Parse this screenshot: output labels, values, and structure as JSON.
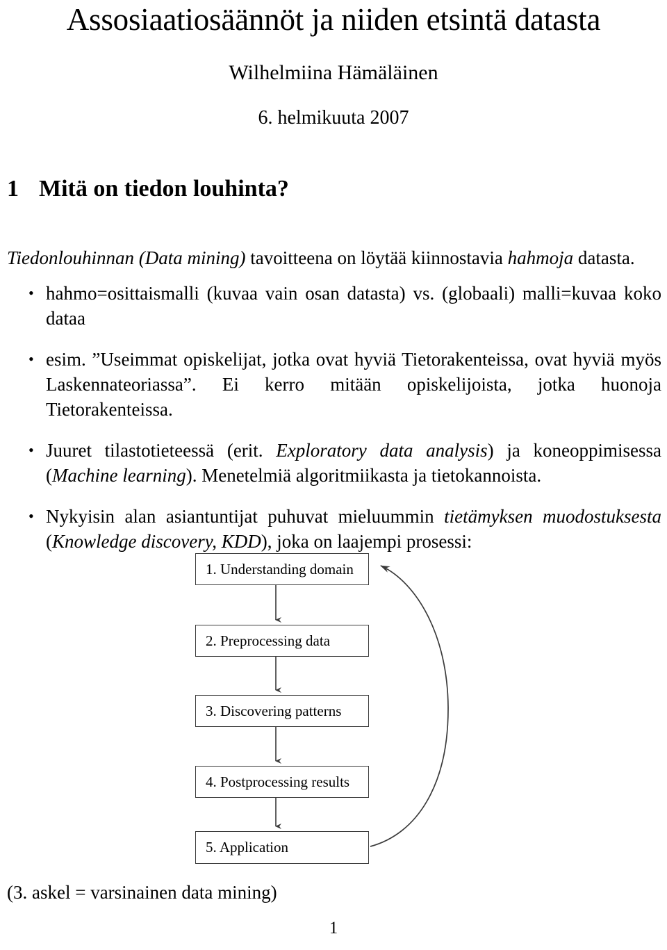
{
  "document": {
    "title": "Assosiaatiosäännöt ja niiden etsintä datasta",
    "author": "Wilhelmiina Hämäläinen",
    "date": "6. helmikuuta 2007",
    "page_number": "1"
  },
  "section": {
    "number": "1",
    "heading": "Mitä on tiedon louhinta?"
  },
  "intro": {
    "italic_lead": "Tiedonlouhinnan",
    "paren_italic": "(Data mining)",
    "mid": " tavoitteena on löytää kiinnostavia ",
    "italic_tail": "hahmoja",
    "tail": " datasta."
  },
  "bullets": [
    {
      "marker": "•",
      "text": "hahmo=osittaismalli (kuvaa vain osan datasta) vs. (globaali) malli=kuvaa koko dataa"
    },
    {
      "marker": "•",
      "text": "esim. ”Useimmat opiskelijat, jotka ovat hyviä Tietorakenteissa, ovat hyviä myös Laskennateoriassa”. Ei kerro mitään opiskelijoista, jotka huonoja Tietorakenteissa."
    },
    {
      "marker": "•",
      "pre": "Juuret tilastotieteessä (erit. ",
      "italic1": "Exploratory data analysis",
      "mid1": ") ja koneoppimisessa (",
      "italic2": "Machine learning",
      "post": "). Menetelmiä algoritmiikasta ja tietokannoista."
    },
    {
      "marker": "•",
      "pre": "Nykyisin alan asiantuntijat puhuvat mieluummin ",
      "italic1": "tietämyksen muodostuksesta",
      "mid1": " (",
      "italic2": "Knowledge discovery, KDD",
      "post": "), joka on laajempi prosessi:"
    }
  ],
  "flowchart": {
    "steps": [
      {
        "label": "1. Understanding domain"
      },
      {
        "label": "2. Preprocessing data"
      },
      {
        "label": "3. Discovering patterns"
      },
      {
        "label": "4. Postprocessing results"
      },
      {
        "label": "5. Application"
      }
    ],
    "feedback_arrow": "from step 5 back to step 1",
    "line_color": "#3a3a3a"
  },
  "closing_note": "(3. askel = varsinainen data mining)"
}
